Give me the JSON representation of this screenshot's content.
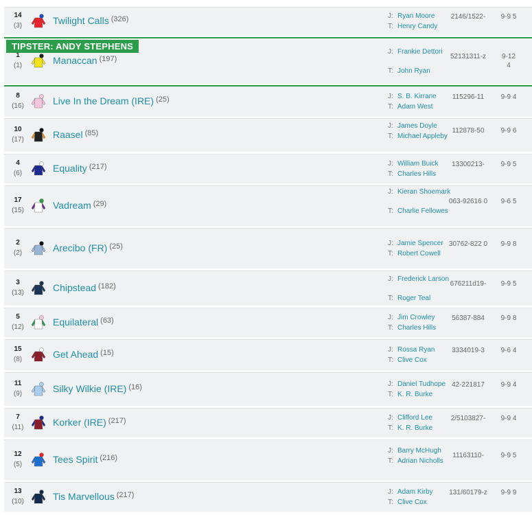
{
  "tipster_label": "TIPSTER: ANDY STEPHENS",
  "jockey_prefix": "J:",
  "trainer_prefix": "T:",
  "runners": [
    {
      "num": "14",
      "draw": "(3)",
      "name": "Twilight Calls",
      "rating": "(326)",
      "jockey": "Ryan Moore",
      "trainer": "Henry Candy",
      "form": "2146/1522-",
      "odds": "9-9 5",
      "silk": {
        "body": "#e8222a",
        "sleeve": "#e8222a",
        "cap": "#1e4fc2"
      }
    },
    {
      "num": "1",
      "draw": "(1)",
      "name": "Manaccan",
      "rating": "(197)",
      "jockey": "Frankie Dettori",
      "trainer": "John Ryan",
      "form": "52131311-z",
      "odds": "9-12 4",
      "silk": {
        "body": "#f3e31c",
        "sleeve": "#f3e31c",
        "cap": "#222222"
      }
    },
    {
      "num": "8",
      "draw": "(16)",
      "name": "Live In the Dream (IRE)",
      "rating": "(25)",
      "jockey": "S. B. Kirrane",
      "trainer": "Adam West",
      "form": "115296-11",
      "odds": "9-9 4",
      "silk": {
        "body": "#f4c6dc",
        "sleeve": "#f4c6dc",
        "cap": "#f4c6dc"
      }
    },
    {
      "num": "10",
      "draw": "(17)",
      "name": "Raasel",
      "rating": "(85)",
      "jockey": "James Doyle",
      "trainer": "Michael Appleby",
      "form": "112878-50",
      "odds": "9-9 6",
      "silk": {
        "body": "#222222",
        "sleeve": "#f0901e",
        "cap": "#111111"
      }
    },
    {
      "num": "4",
      "draw": "(6)",
      "name": "Equality",
      "rating": "(217)",
      "jockey": "William Buick",
      "trainer": "Charles Hills",
      "form": "13300213-",
      "odds": "9-9 5",
      "silk": {
        "body": "#1d2a8f",
        "sleeve": "#1d2a8f",
        "cap": "#ffffff"
      }
    },
    {
      "num": "17",
      "draw": "(15)",
      "name": "Vadream",
      "rating": "(29)",
      "jockey": "Kieran Shoemark",
      "trainer": "Charlie Fellowes",
      "form": "063-92616 0",
      "odds": "9-6 5",
      "silk": {
        "body": "#ffffff",
        "sleeve": "#6b2c8f",
        "cap": "#2c9e4b"
      }
    },
    {
      "num": "2",
      "draw": "(2)",
      "name": "Arecibo (FR)",
      "rating": "(25)",
      "jockey": "Jamie Spencer",
      "trainer": "Robert Cowell",
      "form": "30762-822 0",
      "odds": "9-9 8",
      "silk": {
        "body": "#9ab6d6",
        "sleeve": "#9ab6d6",
        "cap": "#111111"
      }
    },
    {
      "num": "3",
      "draw": "(13)",
      "name": "Chipstead",
      "rating": "(182)",
      "jockey": "Frederick Larson",
      "trainer": "Roger Teal",
      "form": "676211d19-",
      "odds": "9-9 5",
      "silk": {
        "body": "#1b3552",
        "sleeve": "#1b3552",
        "cap": "#1b3552"
      }
    },
    {
      "num": "5",
      "draw": "(12)",
      "name": "Equilateral",
      "rating": "(63)",
      "jockey": "Jim Crowley",
      "trainer": "Charles Hills",
      "form": "56387-884",
      "odds": "9-9 8",
      "silk": {
        "body": "#ffffff",
        "sleeve": "#2c9e4b",
        "cap": "#f4c6dc"
      }
    },
    {
      "num": "15",
      "draw": "(8)",
      "name": "Get Ahead",
      "rating": "(15)",
      "jockey": "Rossa Ryan",
      "trainer": "Clive Cox",
      "form": "3334019-3",
      "odds": "9-6 4",
      "silk": {
        "body": "#8c1d2a",
        "sleeve": "#8c1d2a",
        "cap": "#ffffff"
      }
    },
    {
      "num": "11",
      "draw": "(9)",
      "name": "Silky Wilkie (IRE)",
      "rating": "(16)",
      "jockey": "Daniel Tudhope",
      "trainer": "K. R. Burke",
      "form": "42-221817",
      "odds": "9-9 4",
      "silk": {
        "body": "#a9cdf0",
        "sleeve": "#a9cdf0",
        "cap": "#a9cdf0"
      }
    },
    {
      "num": "7",
      "draw": "(11)",
      "name": "Korker (IRE)",
      "rating": "(217)",
      "jockey": "Clifford Lee",
      "trainer": "K. R. Burke",
      "form": "2/5103827-",
      "odds": "9-9 4",
      "silk": {
        "body": "#8c1d2a",
        "sleeve": "#1d2a8f",
        "cap": "#1d2a8f"
      }
    },
    {
      "num": "12",
      "draw": "(5)",
      "name": "Tees Spirit",
      "rating": "(216)",
      "jockey": "Barry McHugh",
      "trainer": "Adrian Nicholls",
      "form": "11163110-",
      "odds": "9-9 5",
      "silk": {
        "body": "#1e6fd0",
        "sleeve": "#1e6fd0",
        "cap": "#e8222a"
      }
    },
    {
      "num": "13",
      "draw": "(10)",
      "name": "Tis Marvellous",
      "rating": "(217)",
      "jockey": "Adam Kirby",
      "trainer": "Clive Cox",
      "form": "131/60179-z",
      "odds": "9-9 9",
      "silk": {
        "body": "#132a4a",
        "sleeve": "#132a4a",
        "cap": "#132a4a"
      }
    }
  ]
}
